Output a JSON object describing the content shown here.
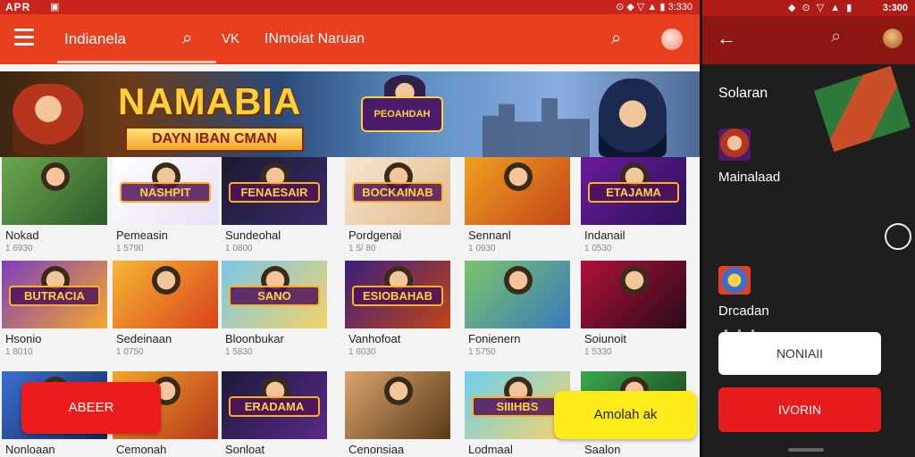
{
  "status_bar": {
    "time": "APR",
    "left_icon": "notification-icon",
    "right_text": "⊙ ◆ ▽ ▲ ▮ 3:330"
  },
  "app_bar": {
    "title": "Indianela",
    "tab_vk": "VK",
    "tab_second": "INmoiat Naruan"
  },
  "banner": {
    "title": "NAMABIA",
    "subtitle": "DAYN IBAN CMAN",
    "center_logo": "PEOAHDAH"
  },
  "games": [
    {
      "name": "Nokad",
      "meta": "1 6930",
      "logo": "",
      "colors": [
        "#6aa84f",
        "#2d5a2a"
      ]
    },
    {
      "name": "Pemeasin",
      "meta": "1 5790",
      "logo": "NASHPIT",
      "colors": [
        "#ffffff",
        "#e9e0f5"
      ]
    },
    {
      "name": "Sundeohal",
      "meta": "1 0800",
      "logo": "FENAESAIR",
      "colors": [
        "#1b1b2f",
        "#3a2a6a"
      ]
    },
    {
      "name": "Pordgenai",
      "meta": "1 5/ 80",
      "logo": "BOCKAINAB",
      "colors": [
        "#f7e7d0",
        "#e0b98a"
      ]
    },
    {
      "name": "Sennanl",
      "meta": "1 0930",
      "logo": "",
      "colors": [
        "#f0a020",
        "#c2451a"
      ]
    },
    {
      "name": "Indanail",
      "meta": "1 0530",
      "logo": "ETAJAMA",
      "colors": [
        "#6a1b9a",
        "#2b1358"
      ]
    },
    {
      "name": "Hsonio",
      "meta": "1 8010",
      "logo": "BUTRACIA",
      "colors": [
        "#7b3fbf",
        "#f7a72a"
      ]
    },
    {
      "name": "Sedeinaan",
      "meta": "1 0750",
      "logo": "",
      "colors": [
        "#f7b733",
        "#d8431b"
      ]
    },
    {
      "name": "Bloonbukar",
      "meta": "1 5830",
      "logo": "SANO",
      "colors": [
        "#79c7e8",
        "#f2d36b"
      ]
    },
    {
      "name": "Vanhofoat",
      "meta": "1 6030",
      "logo": "ESIOBAHAB",
      "colors": [
        "#3b1f7a",
        "#c2451a"
      ]
    },
    {
      "name": "Fonienern",
      "meta": "1 5750",
      "logo": "",
      "colors": [
        "#7cc46a",
        "#3a7abd"
      ]
    },
    {
      "name": "Soiunoit",
      "meta": "1 5330",
      "logo": "",
      "colors": [
        "#b0123a",
        "#2a0a1a"
      ]
    },
    {
      "name": "Nonloaan",
      "meta": "",
      "logo": "",
      "colors": [
        "#3a6fd0",
        "#142a5a"
      ]
    },
    {
      "name": "Cemonah",
      "meta": "",
      "logo": "",
      "colors": [
        "#f2a527",
        "#b5361c"
      ]
    },
    {
      "name": "Sonloat",
      "meta": "",
      "logo": "ERADAMA",
      "colors": [
        "#1a1a3a",
        "#5a2a8a"
      ]
    },
    {
      "name": "Cenonsiaa",
      "meta": "",
      "logo": "",
      "colors": [
        "#d9a46a",
        "#5a3a1a"
      ]
    },
    {
      "name": "Lodmaal",
      "meta": "",
      "logo": "SIIIHBS",
      "colors": [
        "#6ad0f0",
        "#f7d36b"
      ]
    },
    {
      "name": "Saalon",
      "meta": "",
      "logo": "",
      "colors": [
        "#3aa84f",
        "#1a3a1a"
      ]
    }
  ],
  "buttons": {
    "left": "ABEER",
    "yellow": "Amolah ak"
  },
  "right_panel": {
    "status_time": "3:300",
    "status_icons": "◆ ⊙ ▽ ▲ ▮",
    "section_title": "Solaran",
    "item1_label": "Mainalaad",
    "item2_label": "Drcadan",
    "white_button": "NONIAII",
    "red_button": "IVORIN"
  }
}
